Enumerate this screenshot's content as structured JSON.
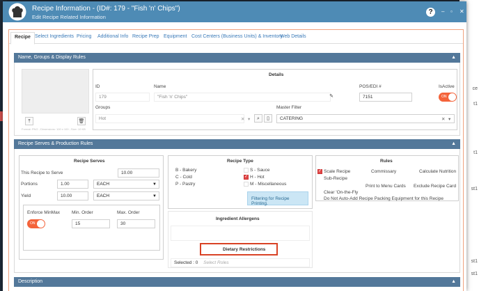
{
  "window": {
    "title": "Recipe Information - (ID#: 179 - \"Fish 'n' Chips\")",
    "subtitle": "Edit Recipe Related Information",
    "help": "?",
    "minimize": "–",
    "maximize": "▫",
    "close": "✕"
  },
  "tabs": [
    "Recipe",
    "Select Ingredients",
    "Pricing",
    "Additional Info",
    "Recipe Prep",
    "Equipment",
    "Cost Centers (Business Units) & Inventory",
    "Web Details"
  ],
  "panels": {
    "name_groups": "Name, Groups & Display Rules",
    "serves": "Recipe Serves & Production Rules",
    "description": "Description"
  },
  "image_caption": "Format: PNG ; Dimensions: 100 x 100 ; Size: 10 KB",
  "details": {
    "heading": "Details",
    "id_label": "ID",
    "id_value": "179",
    "name_label": "Name",
    "name_value": "\"Fish 'n' Chips\"",
    "pos_label": "POS/EDI #",
    "pos_value": "7151",
    "isactive_label": "IsActive",
    "toggle_on": "ON",
    "groups_label": "Groups",
    "groups_value": "Hot",
    "master_filter_label": "Master Filter",
    "master_filter_value": "CATERING"
  },
  "recipe_serves": {
    "heading": "Recipe Serves",
    "serve_label": "This Recipe to Serve",
    "serve_value": "10.00",
    "portions_label": "Portions",
    "portions_value": "1.00",
    "portions_unit": "EACH",
    "yield_label": "Yield",
    "yield_value": "10.00",
    "yield_unit": "EACH",
    "enforce_label": "Enforce MinMax",
    "min_label": "Min. Order",
    "min_value": "15",
    "max_label": "Max. Order",
    "max_value": "30",
    "toggle_on": "ON"
  },
  "recipe_type": {
    "heading": "Recipe Type",
    "options": [
      "B - Bakery",
      "C - Cold",
      "P - Pastry"
    ],
    "checks": [
      "S - Sauce",
      "H - Hot",
      "M - Miscellaneous"
    ],
    "checked": [
      false,
      true,
      false
    ],
    "info": "Filtering for Recipe Printing."
  },
  "allergens": {
    "heading": "Ingredient Allergens"
  },
  "dietary": {
    "heading": "Dietary Restrictions",
    "selected": "Selected : 0",
    "placeholder": "Select Roles"
  },
  "rules": {
    "heading": "Rules",
    "scale_recipe": "Scale Recipe",
    "commissary": "Commissary",
    "calculate_nutrition": "Calculate Nutrition",
    "sub_recipe": "Sub-Recipe",
    "print_menu_cards": "Print to Menu Cards",
    "exclude_recipe_card": "Exclude Recipe Card",
    "clear_on_the_fly": "Clear 'On-the-Fly",
    "no_auto_add": "Do Not Auto-Add Recipe Packing Equipment for this Recipe"
  },
  "background": {
    "right_texts": [
      "ce",
      "t1",
      "t1",
      "st1",
      "st1",
      "st1"
    ]
  },
  "colors": {
    "titlebar": "#4e8bb5",
    "panel_header": "#53789a",
    "accent": "#f4633a",
    "highlight": "#d94225"
  }
}
